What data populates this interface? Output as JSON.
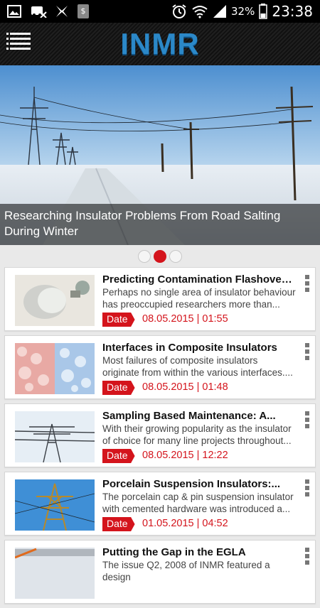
{
  "status": {
    "battery": "32%",
    "time": "23:38"
  },
  "app": {
    "logo": "INMR"
  },
  "hero": {
    "caption": "Researching Insulator Problems  From Road Salting During Winter",
    "slides": 3,
    "active_slide": 2
  },
  "articles": [
    {
      "title": "Predicting Contamination Flashover of...",
      "desc": "Perhaps no single area of insulator behaviour has preoccupied researchers more than...",
      "date_label": "Date",
      "date": "08.05.2015 | 01:55",
      "thumb": "insulator-photo"
    },
    {
      "title": "Interfaces in Composite Insulators",
      "desc": "Most failures of composite insulators originate from within the various interfaces....",
      "date_label": "Date",
      "date": "08.05.2015 | 01:48",
      "thumb": "bubbles-photo"
    },
    {
      "title": "Sampling Based Maintenance: A...",
      "desc": "With their growing popularity as the insulator of choice for many line projects throughout...",
      "date_label": "Date",
      "date": "08.05.2015 | 12:22",
      "thumb": "tower-photo"
    },
    {
      "title": "Porcelain Suspension Insulators:...",
      "desc": "The porcelain cap & pin suspension insulator with cemented hardware was introduced a...",
      "date_label": "Date",
      "date": "01.05.2015 | 04:52",
      "thumb": "lattice-photo"
    },
    {
      "title": "Putting the Gap in the EGLA",
      "desc": "The issue Q2, 2008 of INMR featured a design",
      "date_label": "Date",
      "date": "",
      "thumb": "egla-photo"
    }
  ],
  "colors": {
    "accent": "#d4141c",
    "logo": "#2b88c8"
  }
}
